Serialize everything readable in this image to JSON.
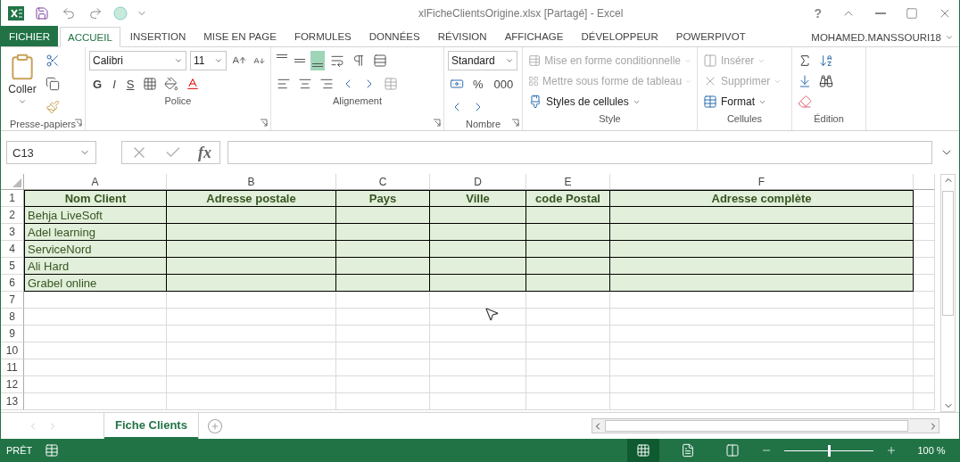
{
  "window": {
    "title": "xlFicheClientsOrigine.xlsx  [Partagé] - Excel",
    "help": "?"
  },
  "tabs": [
    {
      "label": "FICHIER",
      "kind": "file",
      "selected": false
    },
    {
      "label": "ACCUEIL",
      "kind": "tab",
      "selected": true
    },
    {
      "label": "INSERTION",
      "kind": "tab",
      "selected": false
    },
    {
      "label": "MISE EN PAGE",
      "kind": "tab",
      "selected": false
    },
    {
      "label": "FORMULES",
      "kind": "tab",
      "selected": false
    },
    {
      "label": "DONNÉES",
      "kind": "tab",
      "selected": false
    },
    {
      "label": "RÉVISION",
      "kind": "tab",
      "selected": false
    },
    {
      "label": "AFFICHAGE",
      "kind": "tab",
      "selected": false
    },
    {
      "label": "DÉVELOPPEUR",
      "kind": "tab",
      "selected": false
    },
    {
      "label": "POWERPIVOT",
      "kind": "tab",
      "selected": false
    }
  ],
  "account": {
    "name": "MOHAMED.MANSSOURI18"
  },
  "ribbon": {
    "groups": [
      {
        "kind": "clipboard",
        "label": "Presse-papiers",
        "launcher": true,
        "paste": "Coller"
      },
      {
        "kind": "font",
        "label": "Police",
        "launcher": true,
        "font": "Calibri",
        "size": "11",
        "styles": [
          "G",
          "I",
          "S"
        ]
      },
      {
        "kind": "alignment",
        "label": "Alignement",
        "launcher": true,
        "vertical": [
          {
            "selected": false
          },
          {
            "selected": false
          },
          {
            "selected": true
          }
        ]
      },
      {
        "kind": "number",
        "label": "Nombre",
        "launcher": true,
        "format": "Standard",
        "buttons": [
          "%",
          "000"
        ]
      },
      {
        "kind": "styles",
        "label": "Style",
        "items": [
          {
            "label": "Mise en forme conditionnelle",
            "disabled": true
          },
          {
            "label": "Mettre sous forme de tableau",
            "disabled": true
          },
          {
            "label": "Styles de cellules",
            "disabled": false
          }
        ]
      },
      {
        "kind": "cells",
        "label": "Cellules",
        "items": [
          {
            "label": "Insérer",
            "disabled": true
          },
          {
            "label": "Supprimer",
            "disabled": true
          },
          {
            "label": "Format",
            "disabled": false
          }
        ]
      },
      {
        "kind": "editing",
        "label": "Édition"
      }
    ]
  },
  "formula_bar": {
    "name_box": "C13",
    "function_label": "fx"
  },
  "sheet": {
    "columns": [
      "A",
      "B",
      "C",
      "D",
      "E",
      "F"
    ],
    "rows": [
      {
        "number": "1",
        "kind": "header",
        "cells": [
          "Nom Client",
          "Adresse postale",
          "Pays",
          "Ville",
          "code Postal",
          "Adresse complète"
        ]
      },
      {
        "number": "2",
        "kind": "data",
        "cells": [
          "Behja LiveSoft"
        ]
      },
      {
        "number": "3",
        "kind": "data",
        "cells": [
          "Adel learning"
        ]
      },
      {
        "number": "4",
        "kind": "data",
        "cells": [
          "ServiceNord"
        ]
      },
      {
        "number": "5",
        "kind": "data",
        "cells": [
          "Ali Hard"
        ]
      },
      {
        "number": "6",
        "kind": "data",
        "cells": [
          "Grabel online"
        ]
      },
      {
        "number": "7",
        "kind": "empty"
      },
      {
        "number": "8",
        "kind": "empty"
      },
      {
        "number": "9",
        "kind": "empty"
      },
      {
        "number": "10",
        "kind": "empty"
      },
      {
        "number": "11",
        "kind": "empty"
      },
      {
        "number": "12",
        "kind": "empty"
      },
      {
        "number": "13",
        "kind": "empty"
      }
    ]
  },
  "sheet_tabs": [
    {
      "label": "Fiche Clients",
      "selected": true
    }
  ],
  "status_bar": {
    "status": "PRÊT",
    "views": [
      {
        "kind": "normal",
        "selected": true
      },
      {
        "kind": "page_layout",
        "selected": false
      },
      {
        "kind": "page_break",
        "selected": false
      }
    ],
    "zoom": {
      "level": 0.5,
      "reading": "100 %"
    }
  }
}
